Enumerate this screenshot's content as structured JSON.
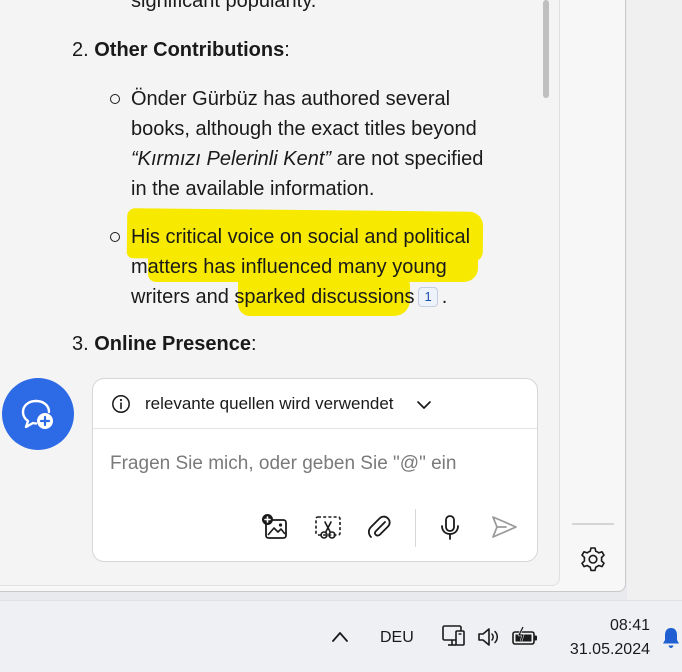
{
  "article": {
    "top_fragment": "significant popularity.",
    "item2": {
      "number": "2.",
      "title": "Other Contributions",
      "suffix": ":"
    },
    "bullet1": {
      "line1": "Önder Gürbüz has authored several",
      "line2": "books, although the exact titles beyond",
      "line3_italic": "“Kırmızı Pelerinli Kent”",
      "line3_rest": " are not specified",
      "line4": "in the available information."
    },
    "bullet2": {
      "line1": "His critical voice on social and political",
      "line2": "matters has influenced many young",
      "line3": "writers and sparked discussions",
      "citation": "1",
      "end": "."
    },
    "item3": {
      "number": "3.",
      "title": "Online Presence",
      "suffix": ":"
    }
  },
  "composer": {
    "source_label": "relevante quellen wird verwendet",
    "placeholder": "Fragen Sie mich, oder geben Sie \"@\" ein"
  },
  "taskbar": {
    "language": "DEU",
    "time": "08:41",
    "date": "31.05.2024"
  },
  "colors": {
    "highlight": "#f7ea00",
    "accent": "#2d6ae6"
  }
}
